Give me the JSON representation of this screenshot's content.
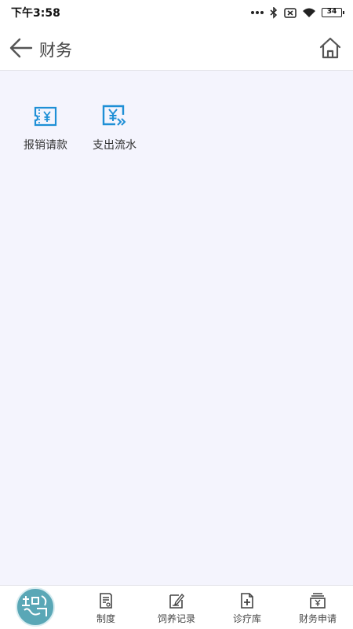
{
  "status_bar": {
    "time": "下午3:58",
    "battery": "34"
  },
  "header": {
    "title": "财务"
  },
  "grid": [
    {
      "label": "报销请款",
      "icon": "reimbursement-voucher-icon"
    },
    {
      "label": "支出流水",
      "icon": "expense-flow-icon"
    }
  ],
  "tabbar": {
    "logo_icon": "app-logo-icon",
    "tabs": [
      {
        "label": "制度",
        "icon": "document-icon"
      },
      {
        "label": "饲养记录",
        "icon": "edit-record-icon"
      },
      {
        "label": "诊疗库",
        "icon": "medical-file-icon"
      },
      {
        "label": "财务申请",
        "icon": "finance-icon"
      }
    ]
  },
  "colors": {
    "accent": "#1e8fd6",
    "background": "#f4f4fd",
    "logo": "#5aa7b6"
  }
}
